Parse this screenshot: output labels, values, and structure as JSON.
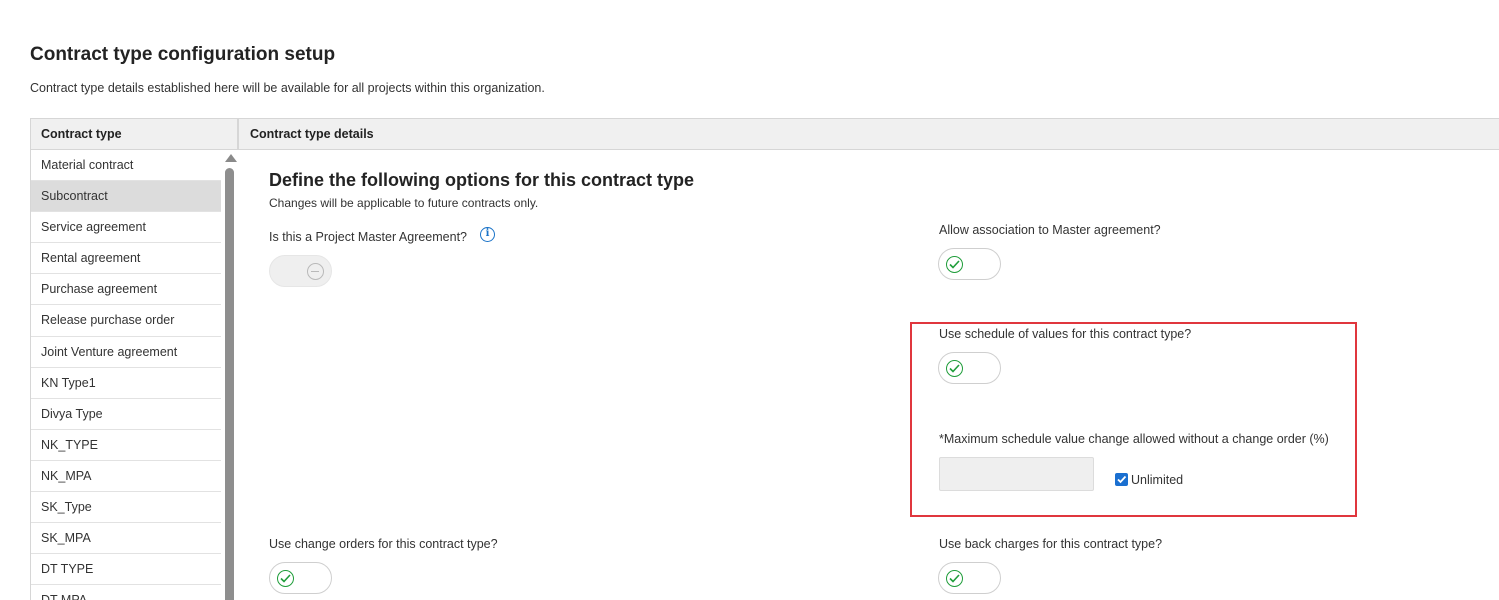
{
  "page": {
    "title": "Contract type configuration setup",
    "subtitle": "Contract type details established here will be available for all projects within this organization."
  },
  "left_panel": {
    "header": "Contract type",
    "items": [
      {
        "label": "Material contract"
      },
      {
        "label": "Subcontract",
        "selected": true
      },
      {
        "label": "Service agreement"
      },
      {
        "label": "Rental agreement"
      },
      {
        "label": "Purchase agreement"
      },
      {
        "label": "Release purchase order"
      },
      {
        "label": "Joint Venture agreement"
      },
      {
        "label": "KN Type1"
      },
      {
        "label": "Divya Type"
      },
      {
        "label": "NK_TYPE"
      },
      {
        "label": "NK_MPA"
      },
      {
        "label": "SK_Type"
      },
      {
        "label": "SK_MPA"
      },
      {
        "label": "DT TYPE"
      },
      {
        "label": "DT MPA"
      }
    ]
  },
  "right_panel": {
    "header": "Contract type details",
    "section_title": "Define the following options for this contract type",
    "section_subtitle": "Changes will be applicable to future contracts only.",
    "fields": {
      "project_master": {
        "label": "Is this a Project Master Agreement?",
        "info_icon": "i",
        "state": "off-disabled"
      },
      "master_association": {
        "label": "Allow association to Master agreement?",
        "state": "on"
      },
      "schedule_values": {
        "label": "Use schedule of values for this contract type?",
        "state": "on"
      },
      "max_change": {
        "label": "*Maximum schedule value change allowed without a change order (%)",
        "value": "",
        "unlimited_label": "Unlimited",
        "unlimited_checked": true
      },
      "change_orders": {
        "label": "Use change orders for this contract type?",
        "state": "on"
      },
      "back_charges": {
        "label": "Use back charges for this contract type?",
        "state": "on"
      }
    }
  },
  "colors": {
    "highlight": "#e0363d",
    "toggle_on": "#1f9d3a",
    "info": "#1a73c8",
    "checkbox": "#1a6fd0"
  }
}
